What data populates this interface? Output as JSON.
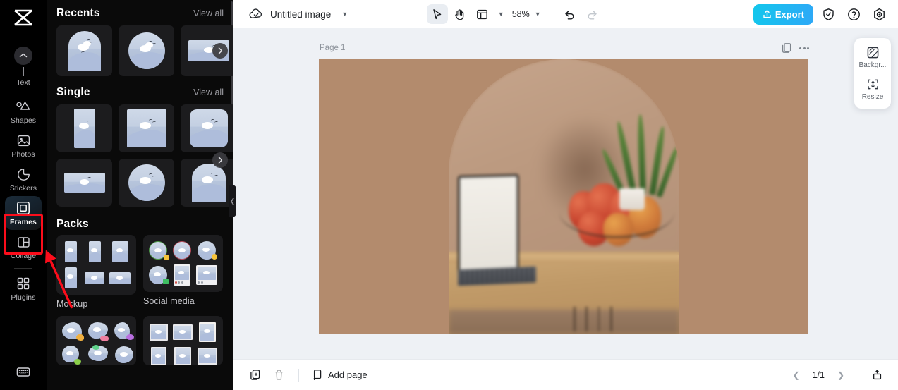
{
  "rail": {
    "logo_icon": "capcut-logo-icon",
    "items": [
      {
        "label": "Text",
        "icon": "text-icon"
      },
      {
        "label": "Shapes",
        "icon": "shapes-icon"
      },
      {
        "label": "Photos",
        "icon": "photos-icon"
      },
      {
        "label": "Stickers",
        "icon": "stickers-icon"
      },
      {
        "label": "Frames",
        "icon": "frames-icon",
        "active": true
      },
      {
        "label": "Collage",
        "icon": "collage-icon"
      },
      {
        "label": "Plugins",
        "icon": "plugins-icon"
      }
    ],
    "keyboard_icon": "keyboard-icon",
    "highlight_color": "#fc0d1b"
  },
  "panel": {
    "sections": [
      {
        "title": "Recents",
        "view_all": "View all"
      },
      {
        "title": "Single",
        "view_all": "View all"
      },
      {
        "title": "Packs"
      }
    ],
    "packs": [
      {
        "label": "Mockup"
      },
      {
        "label": "Social media"
      }
    ],
    "scroll_next_icon": "chevron-right-icon",
    "collapse_icon": "chevron-left-icon"
  },
  "topbar": {
    "cloud_icon": "cloud-saved-icon",
    "title": "Untitled image",
    "title_chevron": "chevron-down-icon",
    "tools": [
      {
        "name": "select-tool",
        "icon": "cursor-icon",
        "selected": true
      },
      {
        "name": "hand-tool",
        "icon": "hand-icon",
        "selected": false
      },
      {
        "name": "layout-tool",
        "icon": "layout-icon",
        "selected": false
      }
    ],
    "zoom_value": "58%",
    "zoom_chevron": "chevron-down-icon",
    "undo_icon": "undo-icon",
    "redo_icon": "redo-icon",
    "export_label": "Export",
    "export_icon": "upload-icon",
    "export_color": "#16bdee",
    "shield_icon": "shield-check-icon",
    "help_icon": "help-circle-icon",
    "settings_icon": "settings-icon"
  },
  "canvas": {
    "page_label": "Page 1",
    "duplicate_icon": "duplicate-page-icon",
    "more_icon": "more-options-icon",
    "artboard_bg": "#b38b6d"
  },
  "float_panel": {
    "items": [
      {
        "label": "Backgr...",
        "icon": "background-icon"
      },
      {
        "label": "Resize",
        "icon": "resize-icon"
      }
    ]
  },
  "bottombar": {
    "duplicate_icon": "duplicate-icon",
    "delete_icon": "trash-icon",
    "add_page_label": "Add page",
    "add_page_icon": "add-page-icon",
    "prev_icon": "chevron-left-icon",
    "page_count": "1/1",
    "next_icon": "chevron-right-icon",
    "panel_toggle_icon": "panel-toggle-icon"
  }
}
